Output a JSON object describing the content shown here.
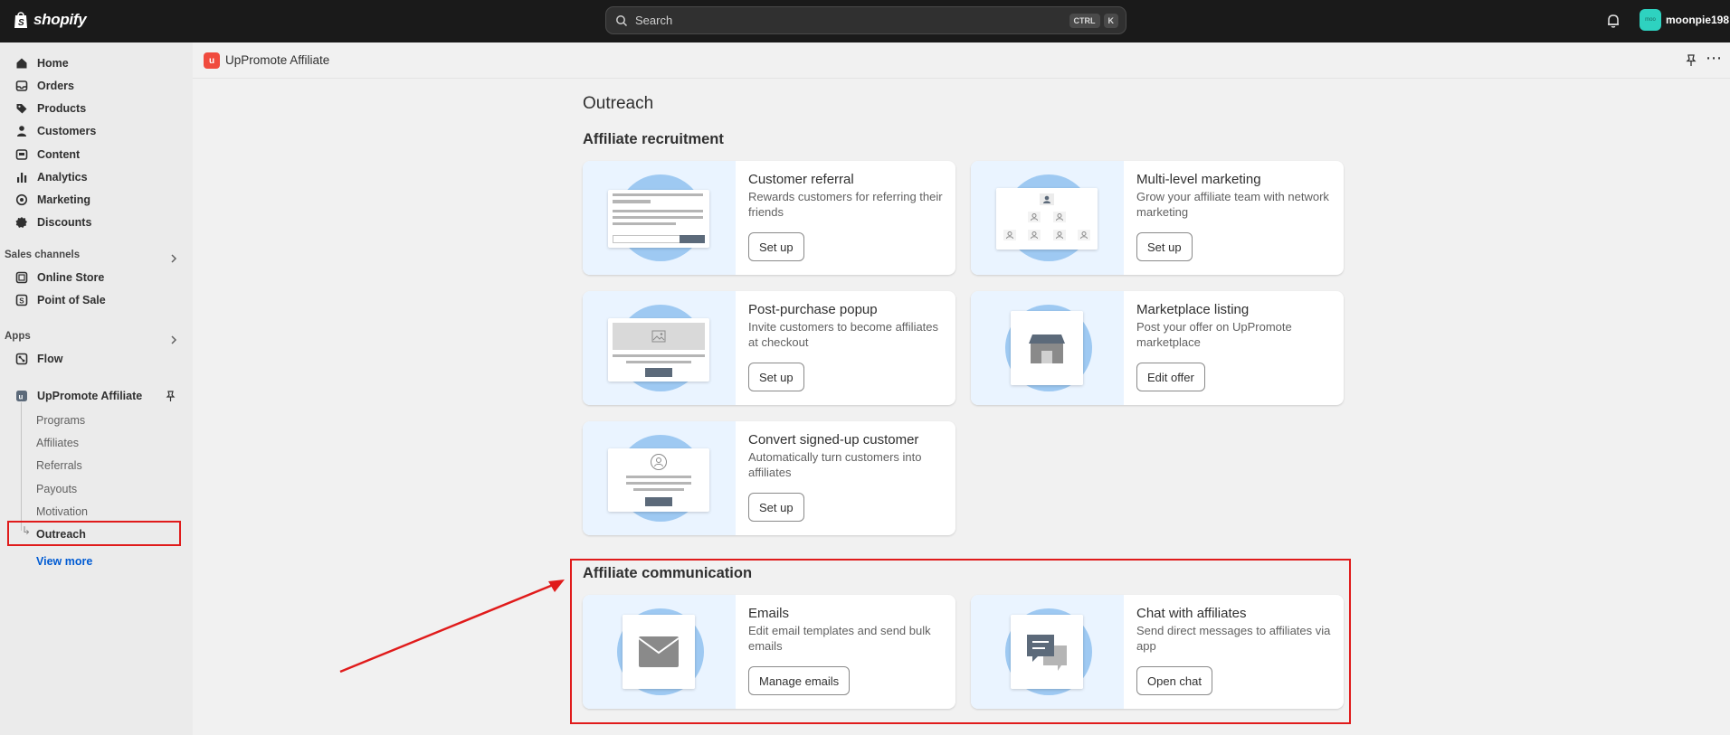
{
  "topbar": {
    "brand": "shopify",
    "search_placeholder": "Search",
    "shortcut_ctrl": "CTRL",
    "shortcut_k": "K",
    "avatar_text": "moo",
    "username": "moonpie198"
  },
  "sidebar": {
    "items": [
      {
        "label": "Home",
        "icon": "home-icon"
      },
      {
        "label": "Orders",
        "icon": "inbox-icon"
      },
      {
        "label": "Products",
        "icon": "tag-icon"
      },
      {
        "label": "Customers",
        "icon": "person-icon"
      },
      {
        "label": "Content",
        "icon": "content-icon"
      },
      {
        "label": "Analytics",
        "icon": "bar-chart-icon"
      },
      {
        "label": "Marketing",
        "icon": "target-icon"
      },
      {
        "label": "Discounts",
        "icon": "discount-icon"
      }
    ],
    "sales_channels_label": "Sales channels",
    "sales_channels": [
      {
        "label": "Online Store",
        "icon": "store-icon"
      },
      {
        "label": "Point of Sale",
        "icon": "pos-icon"
      }
    ],
    "apps_label": "Apps",
    "apps": [
      {
        "label": "Flow",
        "icon": "flow-icon"
      },
      {
        "label": "UpPromote Affiliate",
        "icon": "app-icon"
      }
    ],
    "sub_items": [
      "Programs",
      "Affiliates",
      "Referrals",
      "Payouts",
      "Motivation"
    ],
    "active_sub": "Outreach",
    "view_more": "View more"
  },
  "appbar": {
    "app_name": "UpPromote Affiliate"
  },
  "main": {
    "page_title": "Outreach",
    "recruitment_title": "Affiliate recruitment",
    "communication_title": "Affiliate communication",
    "cards": [
      {
        "title": "Customer referral",
        "desc": "Rewards customers for referring their friends",
        "button": "Set up"
      },
      {
        "title": "Multi-level marketing",
        "desc": "Grow your affiliate team with network marketing",
        "button": "Set up"
      },
      {
        "title": "Post-purchase popup",
        "desc": "Invite customers to become affiliates at checkout",
        "button": "Set up"
      },
      {
        "title": "Marketplace listing",
        "desc": "Post your offer on UpPromote marketplace",
        "button": "Edit offer"
      },
      {
        "title": "Convert signed-up customer",
        "desc": "Automatically turn customers into affiliates",
        "button": "Set up"
      },
      {
        "title": "Emails",
        "desc": "Edit email templates and send bulk emails",
        "button": "Manage emails"
      },
      {
        "title": "Chat with affiliates",
        "desc": "Send direct messages to affiliates via app",
        "button": "Open chat"
      }
    ]
  },
  "colors": {
    "topbar": "#1a1a1a",
    "accent_link": "#005bd3",
    "annotation": "#e01b1b",
    "illustration_bg": "#eaf4ff",
    "illustration_circle": "#9ec9f2"
  }
}
